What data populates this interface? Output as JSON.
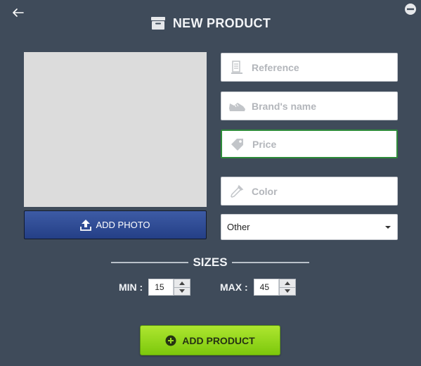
{
  "header": {
    "title": "NEW PRODUCT",
    "icon": "archive-box-icon"
  },
  "photo": {
    "add_label": "ADD PHOTO",
    "icon": "upload-icon"
  },
  "fields": {
    "reference": {
      "placeholder": "Reference",
      "icon": "reference-icon"
    },
    "brand": {
      "placeholder": "Brand's name",
      "icon": "shoe-icon"
    },
    "price": {
      "placeholder": "Price",
      "icon": "price-tag-icon"
    },
    "color": {
      "placeholder": "Color",
      "icon": "eyedropper-icon"
    }
  },
  "category": {
    "selected": "Other"
  },
  "sizes": {
    "label": "SIZES",
    "min_label": "MIN :",
    "min_value": "15",
    "max_label": "MAX :",
    "max_value": "45"
  },
  "actions": {
    "add_product_label": "ADD PRODUCT",
    "add_product_icon": "plus-circle-icon"
  },
  "colors": {
    "background": "#3f4b5a",
    "photo_button": "#2f4c96",
    "add_product_button": "#8fd31a",
    "focus_border": "#2e8b3a"
  }
}
